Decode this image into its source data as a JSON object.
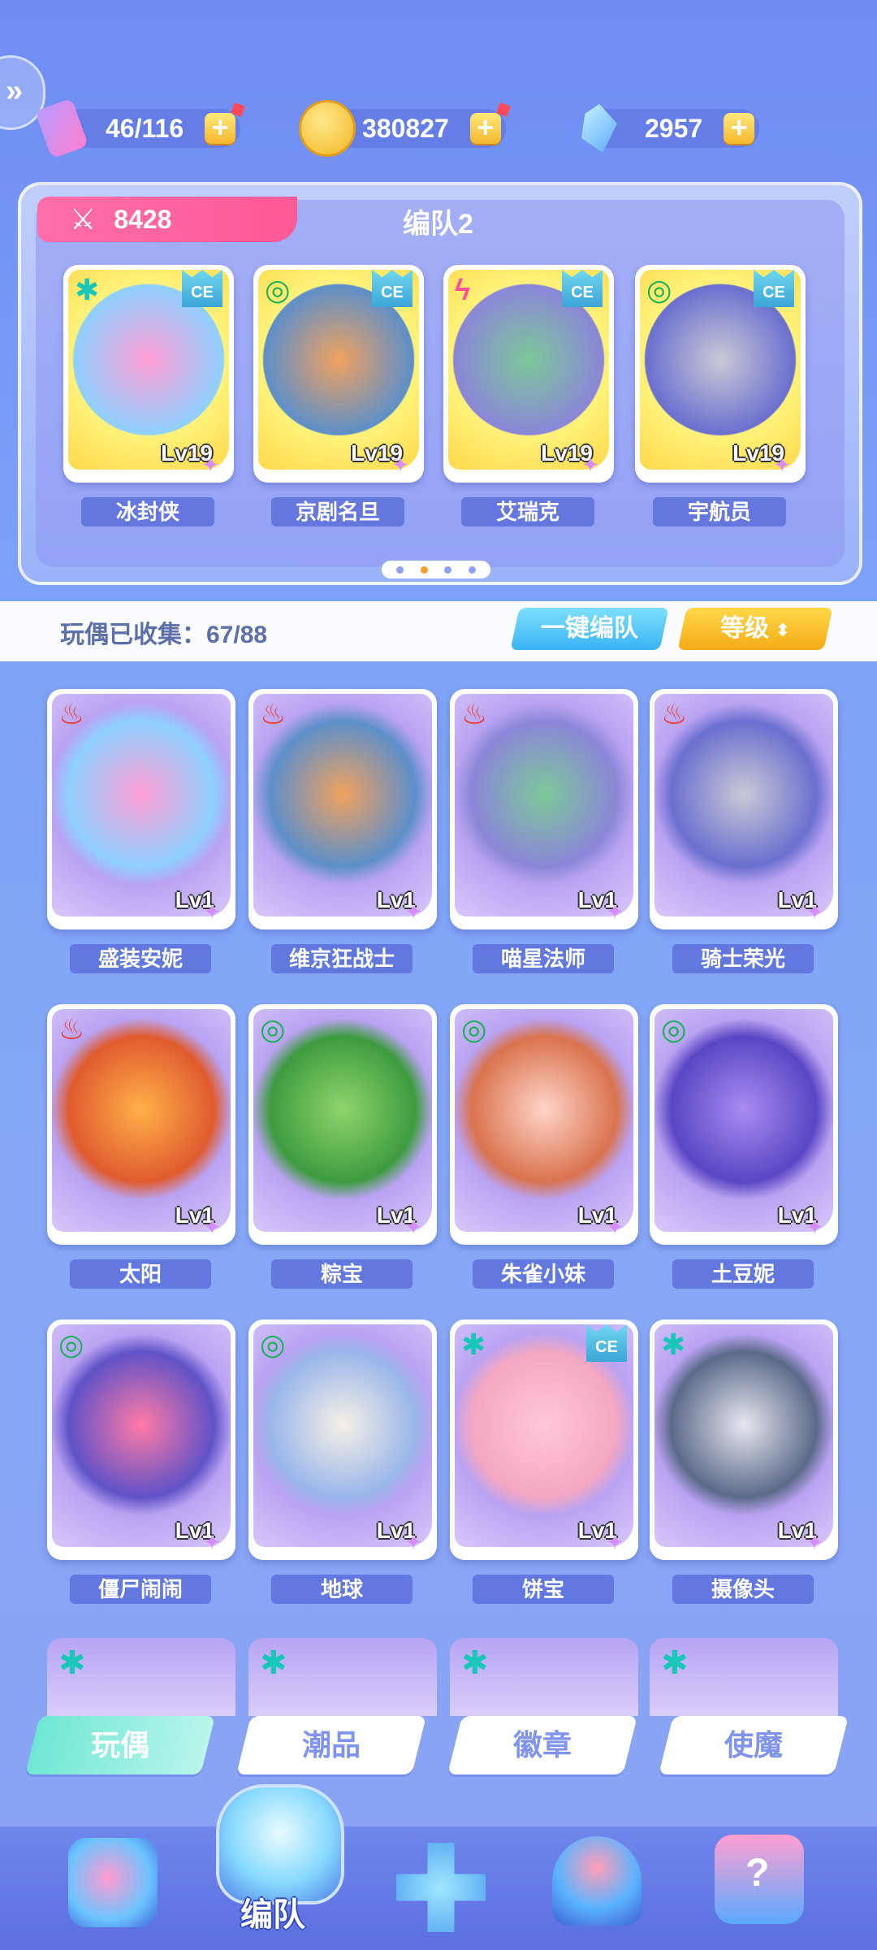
{
  "resources": {
    "tickets": "46/116",
    "coins": "380827",
    "gems": "2957"
  },
  "team": {
    "power": "8428",
    "name": "编队2",
    "members": [
      {
        "name": "冰封侠",
        "level": "Lv19",
        "element": "snow-icon",
        "badge": "CE"
      },
      {
        "name": "京剧名旦",
        "level": "Lv19",
        "element": "wind-icon",
        "badge": "CE"
      },
      {
        "name": "艾瑞克",
        "level": "Lv19",
        "element": "lightning-icon",
        "badge": "CE"
      },
      {
        "name": "宇航员",
        "level": "Lv19",
        "element": "wind-icon",
        "badge": "CE"
      }
    ]
  },
  "collection": {
    "label": "玩偶已收集：67/88",
    "auto_team": "一键编队",
    "sort": "等级"
  },
  "dolls": [
    {
      "name": "盛装安妮",
      "level": "Lv1",
      "element": "fire-icon"
    },
    {
      "name": "维京狂战士",
      "level": "Lv1",
      "element": "fire-icon"
    },
    {
      "name": "喵星法师",
      "level": "Lv1",
      "element": "fire-icon"
    },
    {
      "name": "骑士荣光",
      "level": "Lv1",
      "element": "fire-icon"
    },
    {
      "name": "太阳",
      "level": "Lv1",
      "element": "fire-icon"
    },
    {
      "name": "粽宝",
      "level": "Lv1",
      "element": "wind-icon"
    },
    {
      "name": "朱雀小妹",
      "level": "Lv1",
      "element": "wind-icon"
    },
    {
      "name": "土豆妮",
      "level": "Lv1",
      "element": "wind-icon"
    },
    {
      "name": "僵尸闹闹",
      "level": "Lv1",
      "element": "wind-icon"
    },
    {
      "name": "地球",
      "level": "Lv1",
      "element": "wind-icon"
    },
    {
      "name": "饼宝",
      "level": "Lv1",
      "element": "snow-icon",
      "badge": "CE"
    },
    {
      "name": "摄像头",
      "level": "Lv1",
      "element": "snow-icon"
    }
  ],
  "tabs": [
    "玩偶",
    "潮品",
    "徽章",
    "使魔"
  ],
  "nav": {
    "active_label": "编队"
  }
}
